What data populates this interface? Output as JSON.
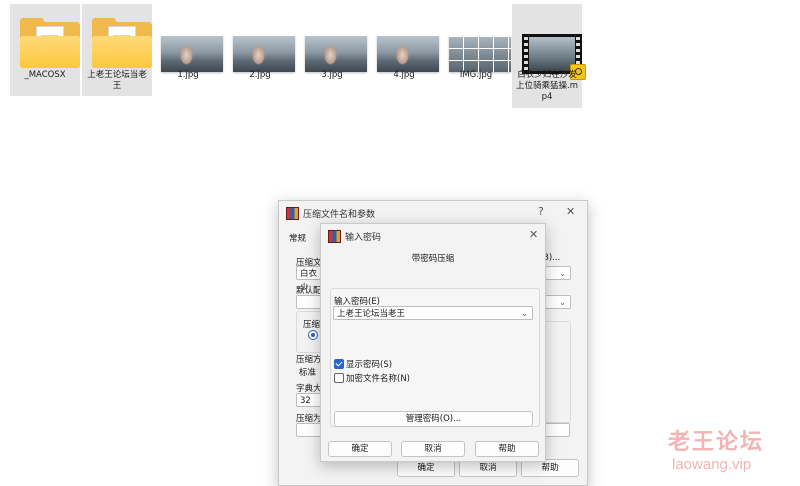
{
  "files": [
    {
      "name": "_MACOSX",
      "icon": "folder-icon",
      "selected": true
    },
    {
      "name": "上老王论坛当老王",
      "icon": "folder-icon",
      "selected": true
    },
    {
      "name": "1.jpg",
      "icon": "image-thumbnail",
      "selected": true
    },
    {
      "name": "2.jpg",
      "icon": "image-thumbnail",
      "selected": true
    },
    {
      "name": "3.jpg",
      "icon": "image-thumbnail",
      "selected": true
    },
    {
      "name": "4.jpg",
      "icon": "image-thumbnail",
      "selected": true
    },
    {
      "name": "IMG.jpg",
      "icon": "image-collage-thumbnail",
      "selected": true
    },
    {
      "name": "白衣少妇在沙发上位骑乘猛操.mp4",
      "icon": "video-thumbnail",
      "selected": true
    }
  ],
  "main_dialog": {
    "title": "压缩文件名和参数",
    "help_glyph": "?",
    "close_glyph": "✕",
    "tab_general": "常规",
    "archive_name_label": "压缩文",
    "archive_name_value": "白衣少",
    "profile_label": "默认配",
    "format_label": "压缩",
    "radio_partial": "R",
    "method_label": "压缩方",
    "method_value": "标准",
    "dict_label": "字典大",
    "dict_value": "32",
    "split_label": "压缩为",
    "right_hint": "B)...",
    "ok": "确定",
    "cancel": "取消",
    "help": "帮助"
  },
  "password_dialog": {
    "title": "输入密码",
    "close_glyph": "✕",
    "heading": "带密码压缩",
    "password_label": "输入密码(E)",
    "password_value": "上老王论坛当老王",
    "show_password": {
      "label": "显示密码(S)",
      "checked": true
    },
    "encrypt_names": {
      "label": "加密文件名称(N)",
      "checked": false
    },
    "manage_button": "管理密码(O)...",
    "ok": "确定",
    "cancel": "取消",
    "help": "帮助"
  },
  "watermark": {
    "line1": "老王论坛",
    "line2": "laowang.vip"
  },
  "colors": {
    "accent": "#2b63c7",
    "folder": "#fcc83c",
    "selection": "#e3e3e3"
  }
}
